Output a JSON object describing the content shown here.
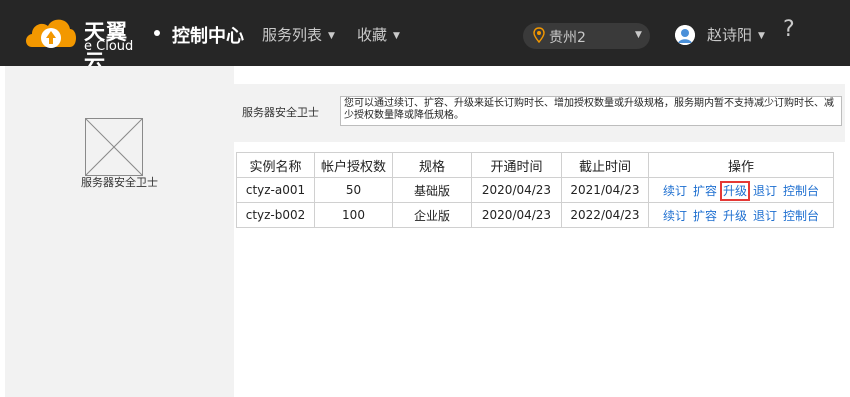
{
  "header": {
    "brand_cn": "天翼云",
    "brand_en": "e Cloud",
    "console": "控制中心",
    "nav": [
      "服务列表",
      "收藏"
    ],
    "region": "贵州2",
    "user": "赵诗阳",
    "help": "?"
  },
  "sidebar": {
    "label": "服务器安全卫士"
  },
  "info": {
    "title": "服务器安全卫士",
    "notice": "您可以通过续订、扩容、升级来延长订购时长、增加授权数量或升级规格，服务期内暂不支持减少订购时长、减少授权数量降或降低规格。"
  },
  "table": {
    "headers": [
      "实例名称",
      "帐户授权数",
      "规格",
      "开通时间",
      "截止时间",
      "操作"
    ],
    "rows": [
      {
        "name": "ctyz-a001",
        "count": "50",
        "spec": "基础版",
        "start": "2020/04/23",
        "end": "2021/04/23"
      },
      {
        "name": "ctyz-b002",
        "count": "100",
        "spec": "企业版",
        "start": "2020/04/23",
        "end": "2022/04/23"
      }
    ],
    "actions": [
      "续订",
      "扩容",
      "升级",
      "退订",
      "控制台"
    ]
  },
  "colors": {
    "topbar": "#262626",
    "link": "#1e6fd0",
    "highlight": "#e53935",
    "panel": "#f2f2f2"
  }
}
